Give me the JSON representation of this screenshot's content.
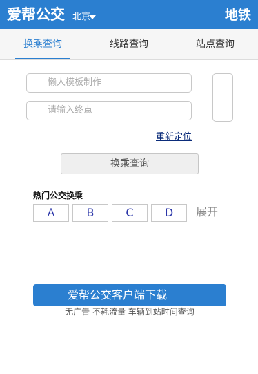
{
  "header": {
    "brand": "爱帮公交",
    "city": "北京",
    "subway_link": "地铁"
  },
  "tabs": [
    {
      "label": "换乘查询",
      "active": true
    },
    {
      "label": "线路查询",
      "active": false
    },
    {
      "label": "站点查询",
      "active": false
    }
  ],
  "form": {
    "start_value": "懒人模板制作",
    "end_placeholder": "请输入终点",
    "relocate": "重新定位",
    "search_button": "换乘查询"
  },
  "hot": {
    "title": "热门公交换乘",
    "letters": [
      "A",
      "B",
      "C",
      "D"
    ],
    "expand": "展开"
  },
  "download": {
    "button": "爱帮公交客户端下载",
    "subtitle": "无广告 不耗流量 车辆到站时间查询"
  },
  "colors": {
    "primary": "#2b7fd0",
    "letter_text": "#2a35a8",
    "link": "#0b2c7a"
  }
}
